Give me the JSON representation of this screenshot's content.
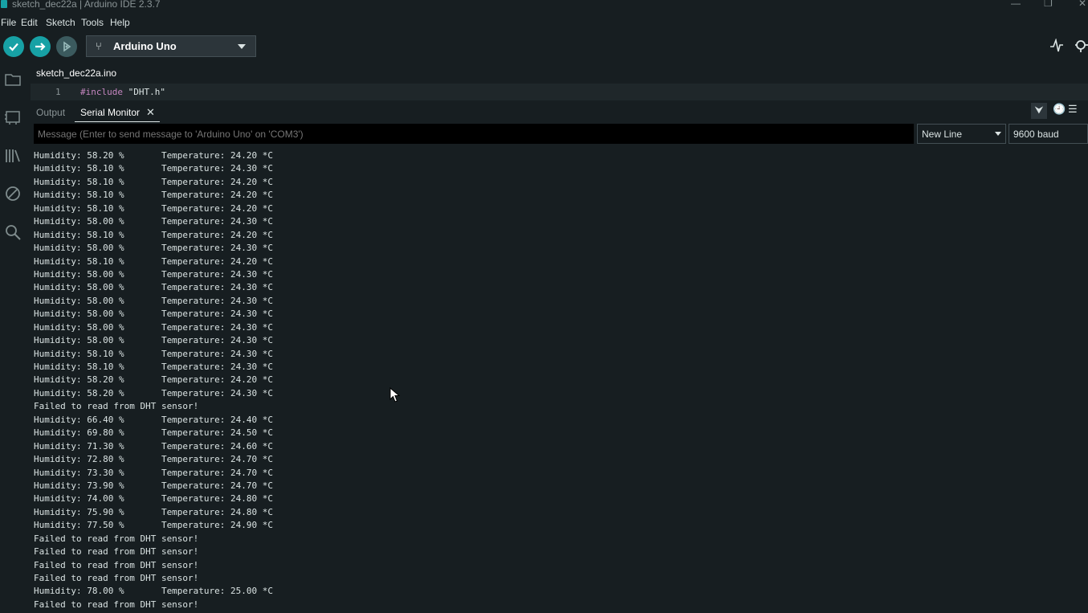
{
  "window": {
    "title": "sketch_dec22a | Arduino IDE 2.3.7"
  },
  "menu": [
    "File",
    "Edit",
    "Sketch",
    "Tools",
    "Help"
  ],
  "toolbar": {
    "verify_icon": "check-icon",
    "upload_icon": "arrow-right-icon",
    "debug_icon": "debug-icon",
    "board_label": "Arduino Uno"
  },
  "editor": {
    "file_tab": "sketch_dec22a.ino",
    "line_number": "1",
    "code_keyword": "#include",
    "code_string": " \"DHT.h\""
  },
  "panel": {
    "tab_output": "Output",
    "tab_serial": "Serial Monitor",
    "message_placeholder": "Message (Enter to send message to 'Arduino Uno' on 'COM3')",
    "line_ending": "New Line",
    "baud_rate": "9600 baud"
  },
  "serial_lines": [
    "Humidity: 58.20 %       Temperature: 24.20 *C",
    "Humidity: 58.10 %       Temperature: 24.30 *C",
    "Humidity: 58.10 %       Temperature: 24.20 *C",
    "Humidity: 58.10 %       Temperature: 24.20 *C",
    "Humidity: 58.10 %       Temperature: 24.20 *C",
    "Humidity: 58.00 %       Temperature: 24.30 *C",
    "Humidity: 58.10 %       Temperature: 24.20 *C",
    "Humidity: 58.00 %       Temperature: 24.30 *C",
    "Humidity: 58.10 %       Temperature: 24.20 *C",
    "Humidity: 58.00 %       Temperature: 24.30 *C",
    "Humidity: 58.00 %       Temperature: 24.30 *C",
    "Humidity: 58.00 %       Temperature: 24.30 *C",
    "Humidity: 58.00 %       Temperature: 24.30 *C",
    "Humidity: 58.00 %       Temperature: 24.30 *C",
    "Humidity: 58.00 %       Temperature: 24.30 *C",
    "Humidity: 58.10 %       Temperature: 24.30 *C",
    "Humidity: 58.10 %       Temperature: 24.30 *C",
    "Humidity: 58.20 %       Temperature: 24.20 *C",
    "Humidity: 58.20 %       Temperature: 24.30 *C",
    "Failed to read from DHT sensor!",
    "Humidity: 66.40 %       Temperature: 24.40 *C",
    "Humidity: 69.80 %       Temperature: 24.50 *C",
    "Humidity: 71.30 %       Temperature: 24.60 *C",
    "Humidity: 72.80 %       Temperature: 24.70 *C",
    "Humidity: 73.30 %       Temperature: 24.70 *C",
    "Humidity: 73.90 %       Temperature: 24.70 *C",
    "Humidity: 74.00 %       Temperature: 24.80 *C",
    "Humidity: 75.90 %       Temperature: 24.80 *C",
    "Humidity: 77.50 %       Temperature: 24.90 *C",
    "Failed to read from DHT sensor!",
    "Failed to read from DHT sensor!",
    "Failed to read from DHT sensor!",
    "Failed to read from DHT sensor!",
    "Humidity: 78.00 %       Temperature: 25.00 *C",
    "Failed to read from DHT sensor!"
  ],
  "colors": {
    "accent": "#17a1a5",
    "background": "#171e21"
  }
}
